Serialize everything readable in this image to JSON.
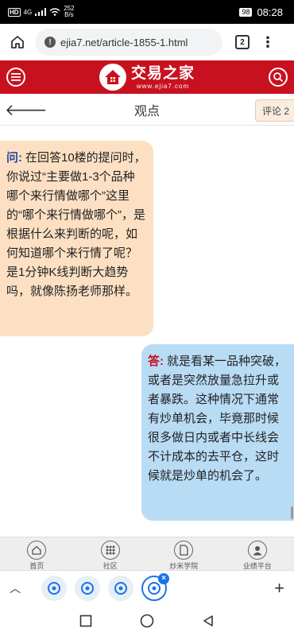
{
  "status_bar": {
    "hd": "HD",
    "network": "4G",
    "speed_value": "252",
    "speed_unit": "B/s",
    "battery": "98",
    "time": "08:28"
  },
  "browser": {
    "url": "ejia7.net/article-1855-1.html",
    "tab_count": "2",
    "icons": [
      "home-icon",
      "warning-icon",
      "tab-switcher-icon",
      "more-vert-icon"
    ]
  },
  "site_header": {
    "logo_name": "交易之家",
    "logo_url": "www.ejia7.com",
    "brand_color": "#c8111f",
    "icons": [
      "menu-icon",
      "logo-house-icon",
      "search-icon"
    ]
  },
  "title_bar": {
    "title": "观点",
    "comment_label": "评论 2"
  },
  "messages": {
    "question_prefix": "问:",
    "question_text": "在回答10楼的提问时，你说过“主要做1-3个品种 哪个来行情做哪个”这里的“哪个来行情做哪个”，是根据什么来判断的呢，如何知道哪个来行情了呢？是1分钟K线判断大趋势吗，就像陈扬老师那样。",
    "question_bg": "#fde0c3",
    "answer_prefix": "答:",
    "answer_text": "就是看某一品种突破，或者是突然放量急拉升或者暴跌。这种情况下通常有炒单机会，毕竟那时候很多做日内或者中长线会不计成本的去平仓，这时候就是炒单的机会了。",
    "answer_bg": "#b9dcf5"
  },
  "bottom_nav": {
    "items": [
      {
        "label": "首页",
        "icon": "home-icon"
      },
      {
        "label": "社区",
        "icon": "grid-icon"
      },
      {
        "label": "炒米学院",
        "icon": "document-icon"
      },
      {
        "label": "业绩平台",
        "icon": "user-icon"
      }
    ]
  },
  "tab_strip": {
    "collapse_icon": "chevron-up-icon",
    "add_label": "+",
    "tab_icons": [
      "site-favicon",
      "site-favicon",
      "site-favicon",
      "site-favicon"
    ],
    "close_label": "×"
  },
  "system_nav": {
    "icons": [
      "recent-apps-icon",
      "home-circle-icon",
      "back-triangle-icon"
    ]
  }
}
